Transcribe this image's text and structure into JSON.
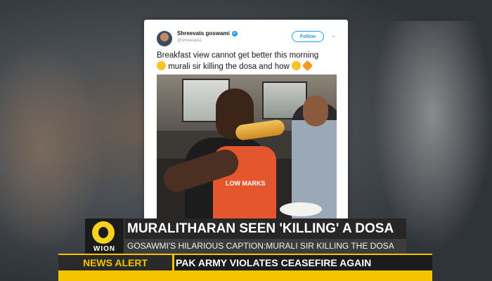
{
  "tweet": {
    "display_name": "Shreevats goswami",
    "handle": "@shreevats1",
    "follow_label": "Follow",
    "text_line1": "Breakfast view cannot get better this morning",
    "text_line2": "murali sir killing the dosa and how",
    "photo_jersey_text": "LOW MARKS"
  },
  "channel": {
    "logo_text": "WION"
  },
  "lower_third": {
    "headline": "MURALITHARAN SEEN 'KILLING' A DOSA",
    "subheadline": "GOSAWMI'S HILARIOUS CAPTION:MURALI SIR KILLING THE DOSA"
  },
  "ticker": {
    "label": "NEWS ALERT",
    "text": "PAK ARMY VIOLATES CEASEFIRE AGAIN"
  },
  "colors": {
    "accent_yellow": "#f5c400",
    "twitter_blue": "#1da1f2",
    "headline_bg": "#272727"
  }
}
